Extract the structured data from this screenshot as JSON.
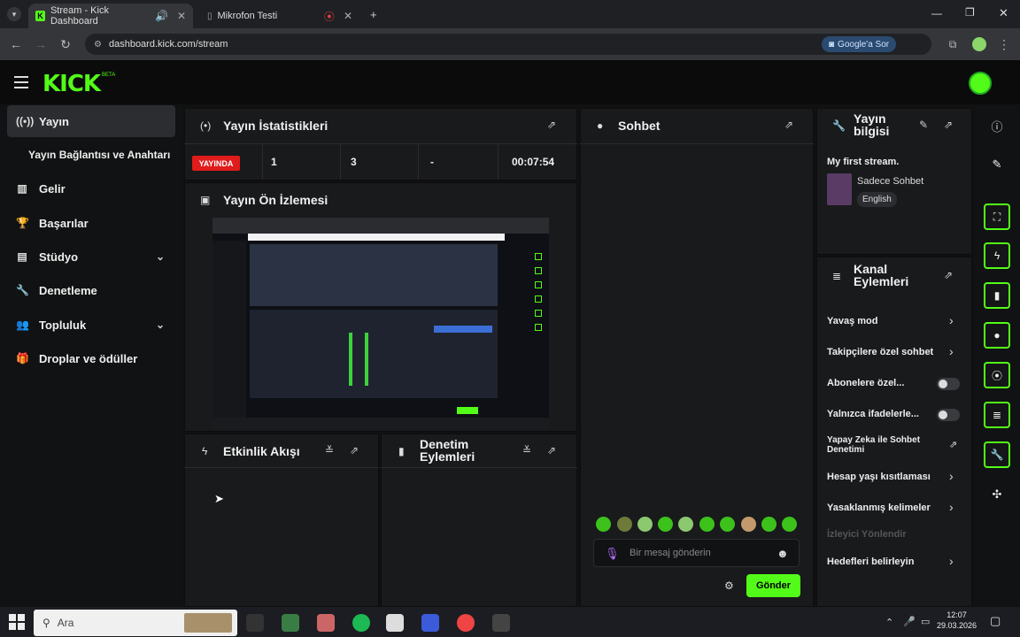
{
  "browser": {
    "tabs": [
      {
        "label": "Stream - Kick Dashboard",
        "active": true
      },
      {
        "label": "Mikrofon Testi",
        "active": false
      }
    ],
    "url": "dashboard.kick.com/stream",
    "google_search_label": "Google'a Sor"
  },
  "header": {
    "logo": "KICK",
    "beta": "BETA"
  },
  "sidebar": {
    "items": [
      {
        "label": "Yayın",
        "icon": "broadcast-icon",
        "active": true
      },
      {
        "label": "Yayın Bağlantısı ve Anahtarı",
        "icon": "",
        "active": false
      },
      {
        "label": "Gelir",
        "icon": "chart-icon",
        "active": false
      },
      {
        "label": "Başarılar",
        "icon": "trophy-icon",
        "active": false
      },
      {
        "label": "Stüdyo",
        "icon": "studio-icon",
        "active": false,
        "expandable": true
      },
      {
        "label": "Denetleme",
        "icon": "wrench-icon",
        "active": false
      },
      {
        "label": "Topluluk",
        "icon": "people-icon",
        "active": false,
        "expandable": true
      },
      {
        "label": "Droplar ve ödüller",
        "icon": "gift-icon",
        "active": false
      }
    ]
  },
  "stats": {
    "title": "Yayın İstatistikleri",
    "live_badge": "YAYINDA",
    "viewers": "1",
    "followers": "3",
    "subs": "-",
    "duration": "00:07:54"
  },
  "preview": {
    "title": "Yayın Ön İzlemesi"
  },
  "activity": {
    "title": "Etkinlik Akışı"
  },
  "moderation": {
    "title": "Denetim Eylemleri"
  },
  "chat": {
    "title": "Sohbet",
    "input_placeholder": "Bir mesaj gönderin",
    "send_label": "Gönder"
  },
  "stream_info": {
    "title": "Yayın bilgisi",
    "stream_title": "My first stream.",
    "category": "Sadece Sohbet",
    "language": "English"
  },
  "channel_actions": {
    "title": "Kanal Eylemleri",
    "items": [
      {
        "label": "Yavaş mod",
        "control": "chevron"
      },
      {
        "label": "Takipçilere özel sohbet",
        "control": "chevron"
      },
      {
        "label": "Abonelere özel...",
        "control": "toggle"
      },
      {
        "label": "Yalnızca ifadelerle...",
        "control": "toggle"
      },
      {
        "label": "Yapay Zeka ile Sohbet Denetimi",
        "control": "external"
      },
      {
        "label": "Hesap yaşı kısıtlaması",
        "control": "chevron"
      },
      {
        "label": "Yasaklanmış kelimeler",
        "control": "chevron"
      },
      {
        "label": "İzleyici Yönlendir",
        "control": "none",
        "disabled": true
      },
      {
        "label": "Hedefleri belirleyin",
        "control": "chevron"
      }
    ]
  },
  "taskbar": {
    "search_placeholder": "Ara",
    "time": "12:07",
    "date": "29.03.2026"
  },
  "colors": {
    "accent": "#53fc18",
    "live": "#e01b1b",
    "panel": "#191a1c",
    "background": "#111213"
  }
}
